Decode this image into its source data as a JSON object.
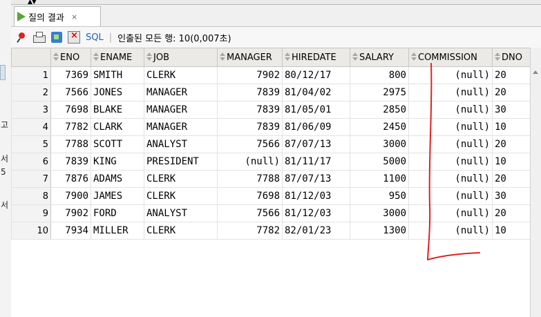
{
  "left_fragments": [
    "고",
    "서",
    "5",
    "서"
  ],
  "tab": {
    "title": "질의 결과",
    "close": "×"
  },
  "toolbar": {
    "sql_label": "SQL",
    "separator": "|",
    "status": "인출된 모든 행: 10(0,007초)"
  },
  "grid": {
    "columns": [
      "ENO",
      "ENAME",
      "JOB",
      "MANAGER",
      "HIREDATE",
      "SALARY",
      "COMMISSION",
      "DNO"
    ],
    "rows": [
      [
        "1",
        "7369",
        "SMITH",
        "CLERK",
        "7902",
        "80/12/17",
        "800",
        "(null)",
        "20"
      ],
      [
        "2",
        "7566",
        "JONES",
        "MANAGER",
        "7839",
        "81/04/02",
        "2975",
        "(null)",
        "20"
      ],
      [
        "3",
        "7698",
        "BLAKE",
        "MANAGER",
        "7839",
        "81/05/01",
        "2850",
        "(null)",
        "30"
      ],
      [
        "4",
        "7782",
        "CLARK",
        "MANAGER",
        "7839",
        "81/06/09",
        "2450",
        "(null)",
        "10"
      ],
      [
        "5",
        "7788",
        "SCOTT",
        "ANALYST",
        "7566",
        "87/07/13",
        "3000",
        "(null)",
        "20"
      ],
      [
        "6",
        "7839",
        "KING",
        "PRESIDENT",
        "(null)",
        "81/11/17",
        "5000",
        "(null)",
        "10"
      ],
      [
        "7",
        "7876",
        "ADAMS",
        "CLERK",
        "7788",
        "87/07/13",
        "1100",
        "(null)",
        "20"
      ],
      [
        "8",
        "7900",
        "JAMES",
        "CLERK",
        "7698",
        "81/12/03",
        "950",
        "(null)",
        "30"
      ],
      [
        "9",
        "7902",
        "FORD",
        "ANALYST",
        "7566",
        "81/12/03",
        "3000",
        "(null)",
        "20"
      ],
      [
        "10",
        "7934",
        "MILLER",
        "CLERK",
        "7782",
        "82/01/23",
        "1300",
        "(null)",
        "10"
      ]
    ]
  },
  "colors": {
    "annotation": "#e02020",
    "play": "#57a639",
    "link": "#1f5fbf"
  }
}
